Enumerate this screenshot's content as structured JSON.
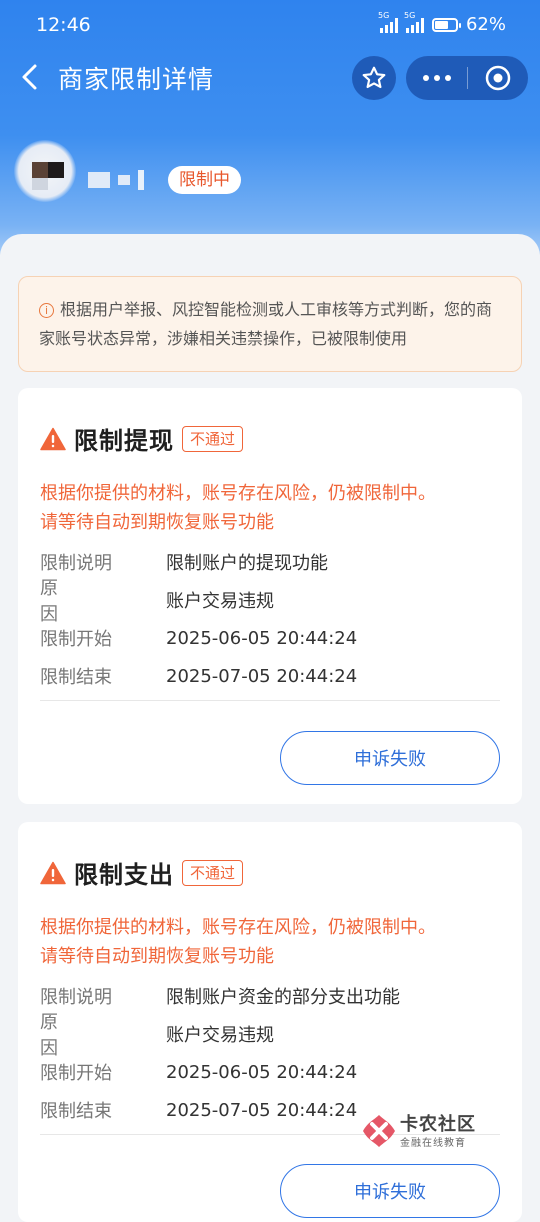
{
  "status_bar": {
    "time": "12:46",
    "network": "5G",
    "battery": "62%"
  },
  "navbar": {
    "title": "商家限制详情"
  },
  "merchant": {
    "status_tag": "限制中"
  },
  "notice": {
    "text": "根据用户举报、风控智能检测或人工审核等方式判断，您的商家账号状态异常，涉嫌相关违禁操作，已被限制使用"
  },
  "cards": [
    {
      "title": "限制提现",
      "status": "不通过",
      "risk_line1": "根据你提供的材料，账号存在风险，仍被限制中。",
      "risk_line2": "请等待自动到期恢复账号功能",
      "rows": [
        {
          "key": "限制说明",
          "value": "限制账户的提现功能"
        },
        {
          "key": "原因",
          "value": "账户交易违规"
        },
        {
          "key": "限制开始",
          "value": "2025-06-05 20:44:24"
        },
        {
          "key": "限制结束",
          "value": "2025-07-05 20:44:24"
        }
      ],
      "button": "申诉失败"
    },
    {
      "title": "限制支出",
      "status": "不通过",
      "risk_line1": "根据你提供的材料，账号存在风险，仍被限制中。",
      "risk_line2": "请等待自动到期恢复账号功能",
      "rows": [
        {
          "key": "限制说明",
          "value": "限制账户资金的部分支出功能"
        },
        {
          "key": "原因",
          "value": "账户交易违规"
        },
        {
          "key": "限制开始",
          "value": "2025-06-05 20:44:24"
        },
        {
          "key": "限制结束",
          "value": "2025-07-05 20:44:24"
        }
      ],
      "button": "申诉失败"
    }
  ],
  "watermark": {
    "main": "卡农社区",
    "sub": "金融在线教育"
  },
  "colors": {
    "primary": "#2f83ee",
    "warning": "#f0663a",
    "notice_bg": "#fdf3ea"
  }
}
